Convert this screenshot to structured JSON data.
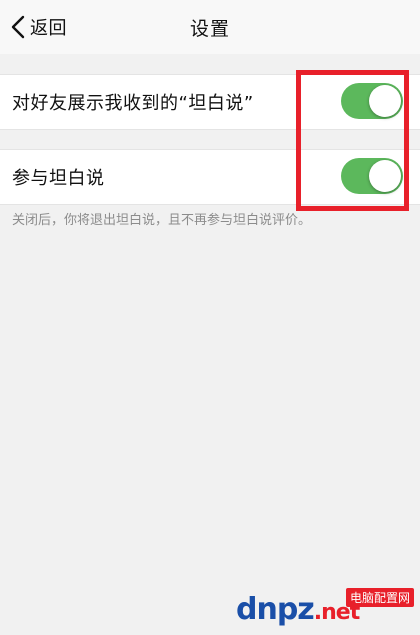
{
  "navbar": {
    "back_label": "返回",
    "title": "设置"
  },
  "settings": {
    "rows": [
      {
        "label": "对好友展示我收到的“坦白说”",
        "enabled": true
      },
      {
        "label": "参与坦白说",
        "enabled": true
      }
    ],
    "footnote": "关闭后，你将退出坦白说，且不再参与坦白说评价。"
  },
  "colors": {
    "toggle_on": "#5cb85c",
    "highlight": "#e8202a",
    "background": "#f1f1f1"
  },
  "icons": {
    "back": "chevron-left-icon"
  },
  "watermark": {
    "domain": "dnpz",
    "tld": ".net",
    "badge": "电脑配置网"
  }
}
